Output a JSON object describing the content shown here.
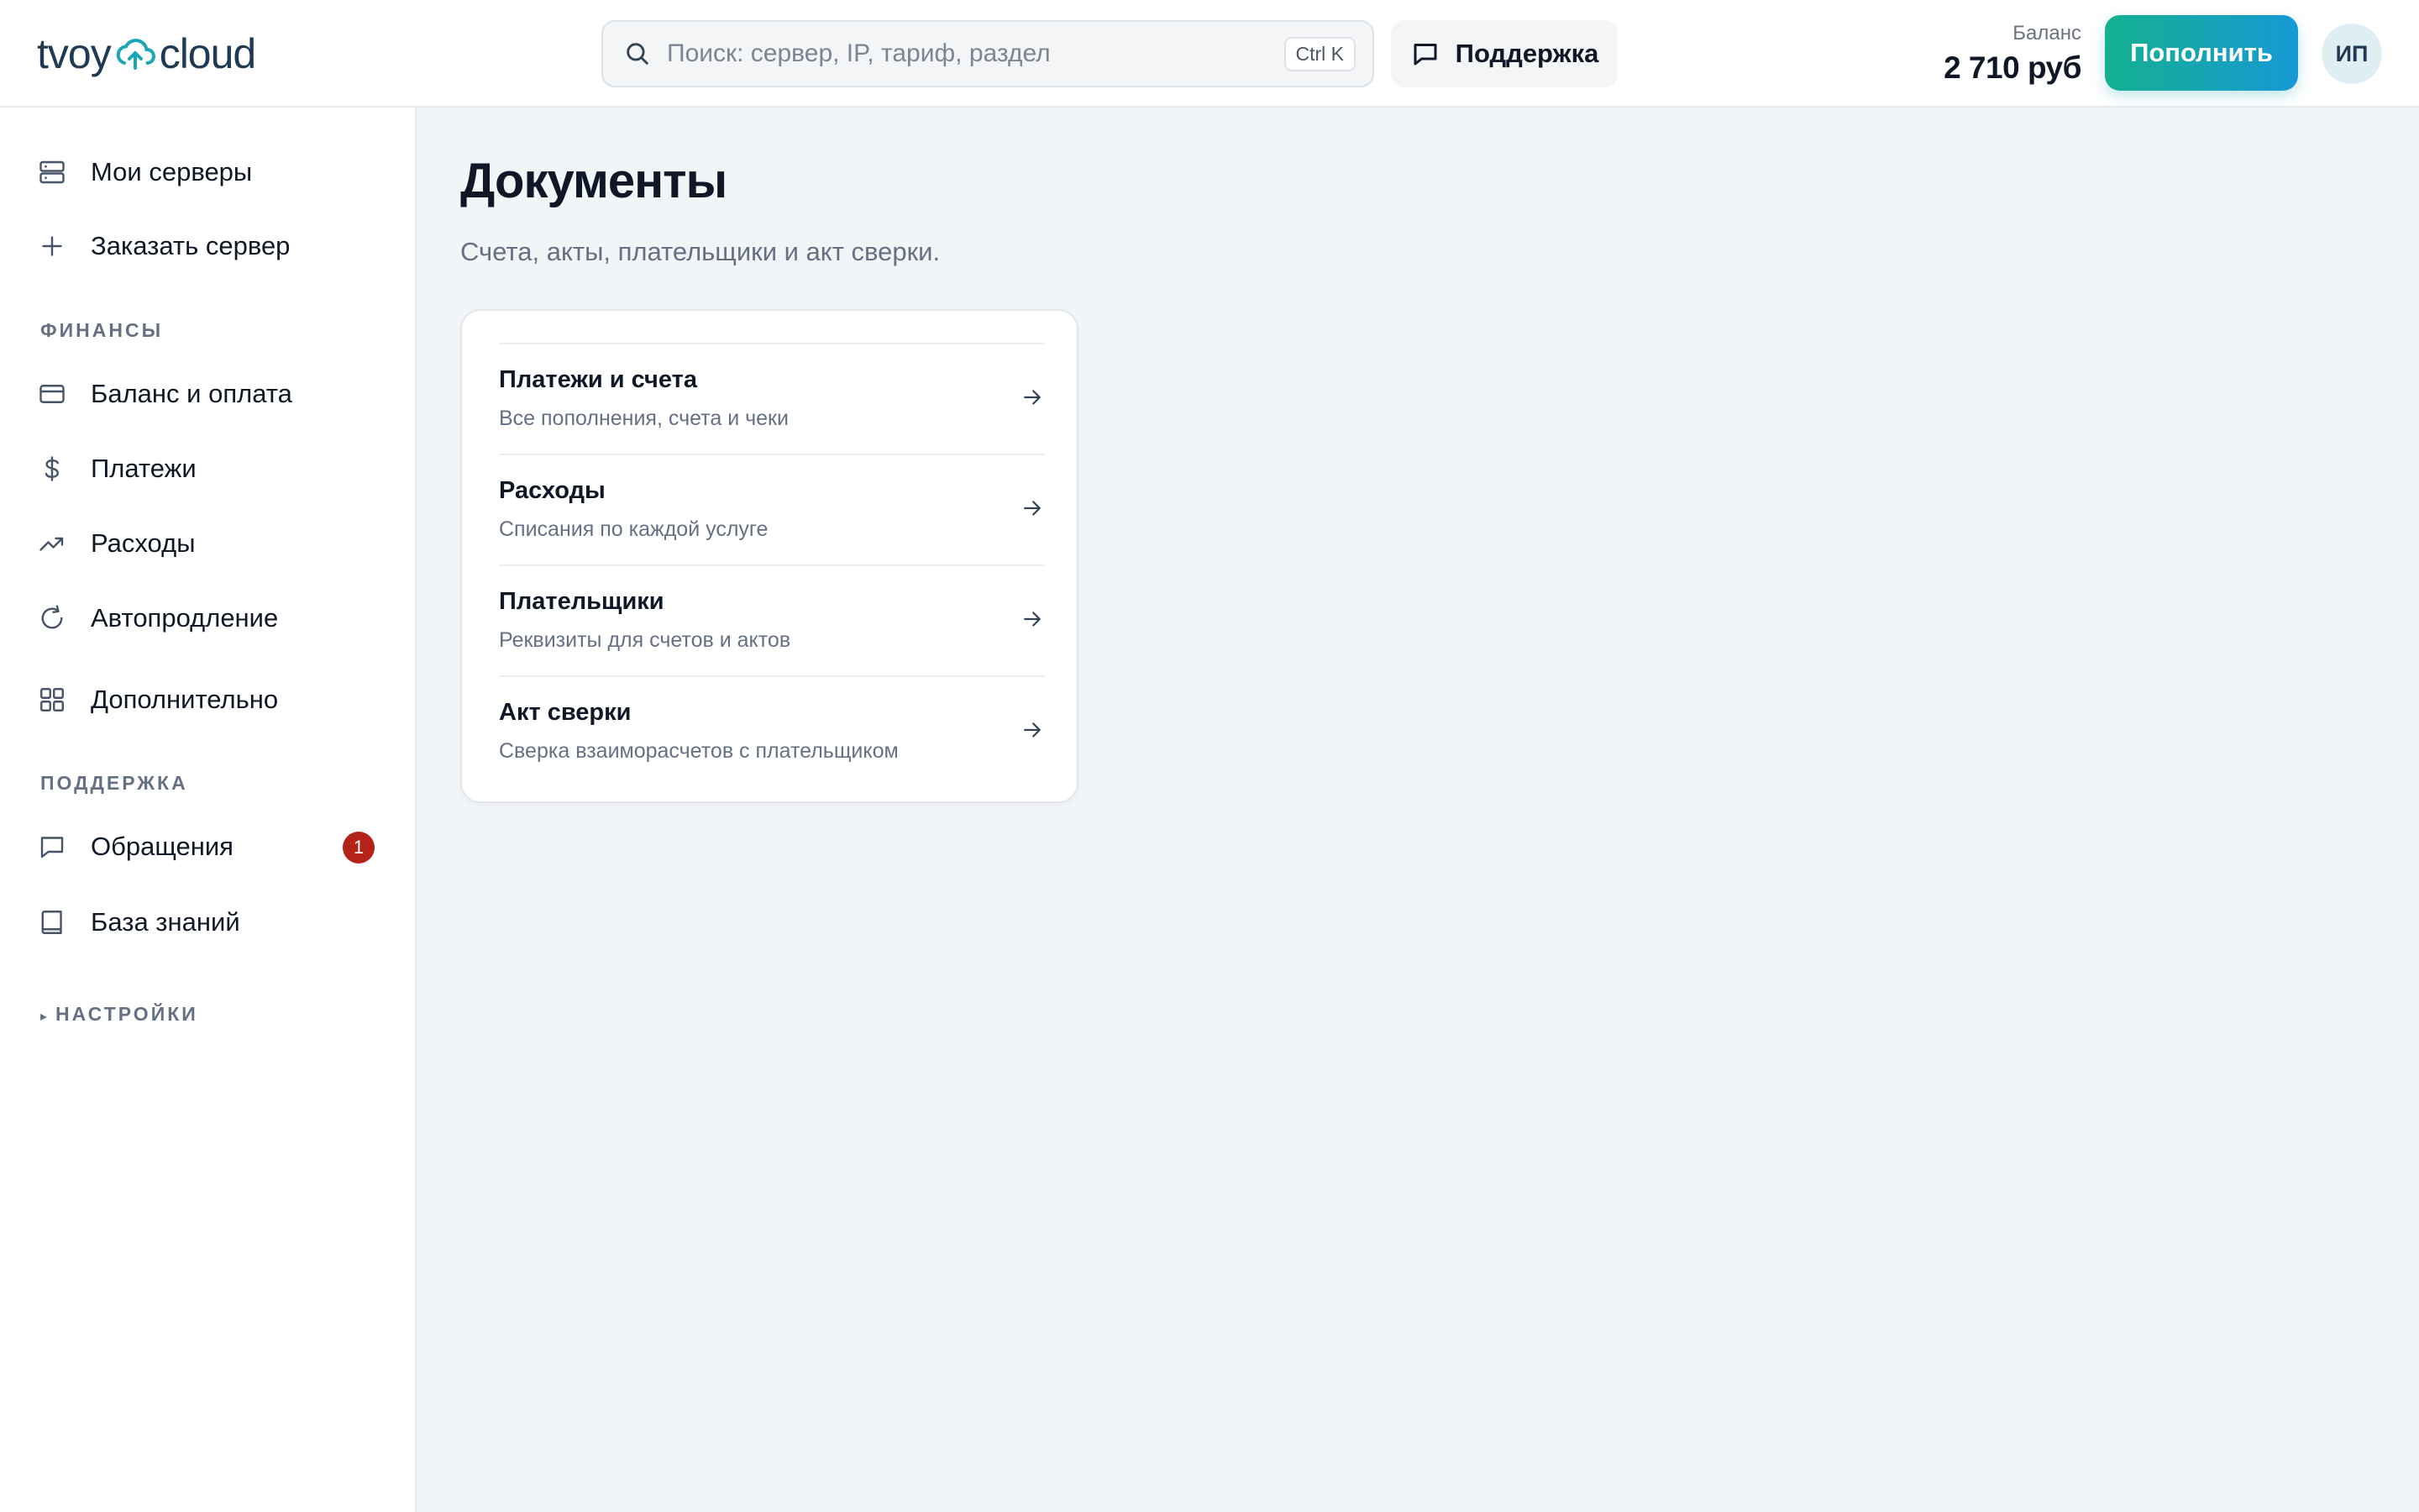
{
  "header": {
    "logo_left": "tvoy",
    "logo_right": "cloud",
    "search": {
      "placeholder": "Поиск: сервер, IP, тариф, раздел",
      "shortcut": "Ctrl K"
    },
    "support_label": "Поддержка",
    "balance_label": "Баланс",
    "balance_value": "2 710 руб",
    "topup_label": "Пополнить",
    "avatar_initials": "ИП"
  },
  "sidebar": {
    "top_items": [
      {
        "label": "Мои серверы",
        "icon": "server-icon"
      },
      {
        "label": "Заказать сервер",
        "icon": "plus-icon"
      }
    ],
    "finance_title": "ФИНАНСЫ",
    "finance_items": [
      {
        "label": "Баланс и оплата",
        "icon": "credit-card-icon"
      },
      {
        "label": "Платежи",
        "icon": "dollar-icon"
      },
      {
        "label": "Расходы",
        "icon": "trending-up-icon"
      },
      {
        "label": "Автопродление",
        "icon": "refresh-icon"
      },
      {
        "label": "Дополнительно",
        "icon": "grid-icon"
      }
    ],
    "support_title": "ПОДДЕРЖКА",
    "support_items": [
      {
        "label": "Обращения",
        "icon": "message-icon",
        "badge": "1"
      },
      {
        "label": "База знаний",
        "icon": "book-icon"
      }
    ],
    "settings_title": "НАСТРОЙКИ"
  },
  "main": {
    "title": "Документы",
    "subtitle": "Счета, акты, плательщики и акт сверки.",
    "documents": [
      {
        "title": "Платежи и счета",
        "description": "Все пополнения, счета и чеки"
      },
      {
        "title": "Расходы",
        "description": "Списания по каждой услуге"
      },
      {
        "title": "Плательщики",
        "description": "Реквизиты для счетов и актов"
      },
      {
        "title": "Акт сверки",
        "description": "Сверка взаиморасчетов с плательщиком"
      }
    ]
  },
  "colors": {
    "accent_start": "#14b08f",
    "accent_end": "#1799d6",
    "badge": "#b42318",
    "page_bg": "#f2f5f7"
  }
}
